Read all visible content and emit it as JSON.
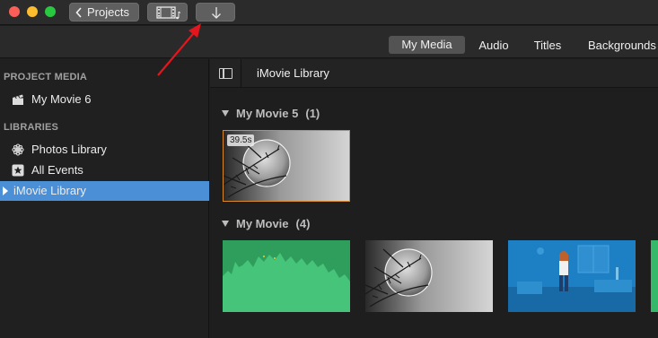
{
  "toolbar": {
    "projects_label": "Projects",
    "media_icon": "film-music-icon",
    "import_icon": "download-arrow-icon"
  },
  "tabs": [
    {
      "label": "My Media",
      "active": true
    },
    {
      "label": "Audio",
      "active": false
    },
    {
      "label": "Titles",
      "active": false
    },
    {
      "label": "Backgrounds",
      "active": false
    }
  ],
  "sidebar": {
    "project_media_heading": "PROJECT MEDIA",
    "project_items": [
      {
        "label": "My Movie 6",
        "icon": "clapperboard-icon"
      }
    ],
    "libraries_heading": "LIBRARIES",
    "library_items": [
      {
        "label": "Photos Library",
        "icon": "flower-icon"
      },
      {
        "label": "All Events",
        "icon": "star-icon"
      },
      {
        "label": "iMovie Library",
        "icon": "disclosure-triangle-icon",
        "selected": true
      }
    ]
  },
  "browser": {
    "title": "iMovie Library",
    "groups": [
      {
        "name": "My Movie 5",
        "count": "(1)",
        "clips": [
          {
            "duration": "39.5s"
          }
        ]
      },
      {
        "name": "My Movie",
        "count": "(4)"
      }
    ]
  },
  "colors": {
    "selection": "#4b8fd7",
    "annotation_arrow": "#e3161d",
    "thumb_green": "#34b86a",
    "thumb_blue": "#1d7fc4"
  }
}
